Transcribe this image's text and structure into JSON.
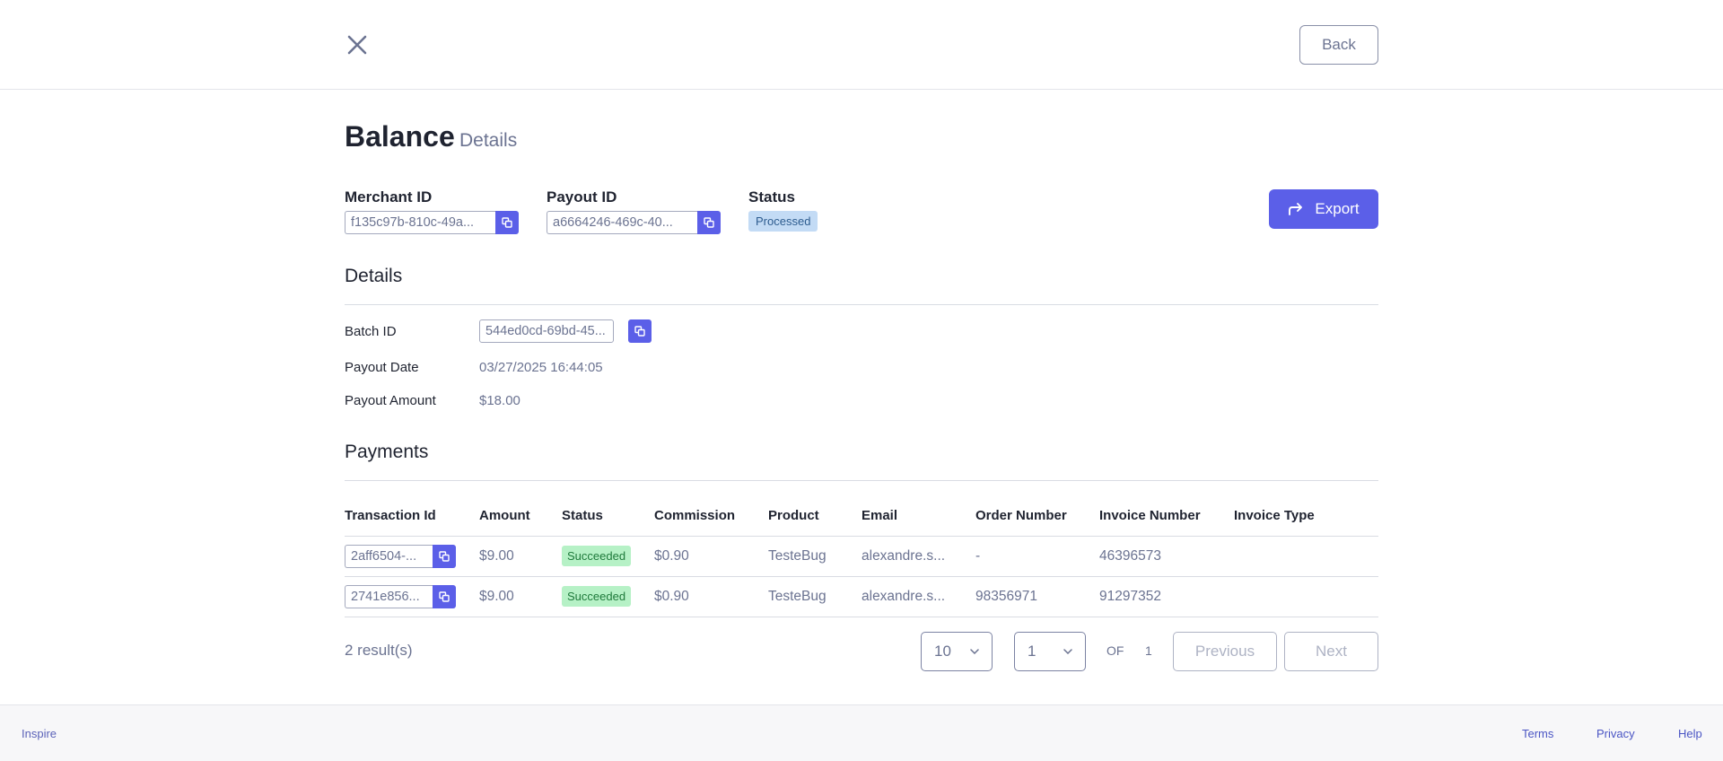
{
  "header": {
    "back_label": "Back"
  },
  "page": {
    "title": "Balance",
    "subtitle": "Details"
  },
  "summary": {
    "merchant_label": "Merchant ID",
    "merchant_value": "f135c97b-810c-49a...",
    "payout_label": "Payout ID",
    "payout_value": "a6664246-469c-40...",
    "status_label": "Status",
    "status_value": "Processed",
    "export_label": "Export"
  },
  "details": {
    "title": "Details",
    "batch_label": "Batch ID",
    "batch_value": "544ed0cd-69bd-45...",
    "date_label": "Payout Date",
    "date_value": "03/27/2025 16:44:05",
    "amount_label": "Payout Amount",
    "amount_value": "$18.00"
  },
  "payments": {
    "title": "Payments",
    "columns": [
      "Transaction Id",
      "Amount",
      "Status",
      "Commission",
      "Product",
      "Email",
      "Order Number",
      "Invoice Number",
      "Invoice Type"
    ],
    "rows": [
      {
        "transaction": "2aff6504-...",
        "amount": "$9.00",
        "status": "Succeeded",
        "commission": "$0.90",
        "product": "TesteBug",
        "email": "alexandre.s...",
        "order": "-",
        "invoice": "46396573",
        "invoice_type": ""
      },
      {
        "transaction": "2741e856...",
        "amount": "$9.00",
        "status": "Succeeded",
        "commission": "$0.90",
        "product": "TesteBug",
        "email": "alexandre.s...",
        "order": "98356971",
        "invoice": "91297352",
        "invoice_type": ""
      }
    ]
  },
  "pagination": {
    "results": "2 result(s)",
    "page_size": "10",
    "current_page": "1",
    "of_label": "OF",
    "total_pages": "1",
    "previous_label": "Previous",
    "next_label": "Next"
  },
  "footer": {
    "brand": "Inspire",
    "terms": "Terms",
    "privacy": "Privacy",
    "help": "Help"
  },
  "colors": {
    "accent": "#5b5fe8",
    "success_bg": "#b6f1c6",
    "processed_bg": "#c3dbf5"
  },
  "icons": {
    "close": "close-icon",
    "copy": "copy-icon",
    "export": "share-arrow-icon",
    "chevron": "chevron-down-icon"
  }
}
